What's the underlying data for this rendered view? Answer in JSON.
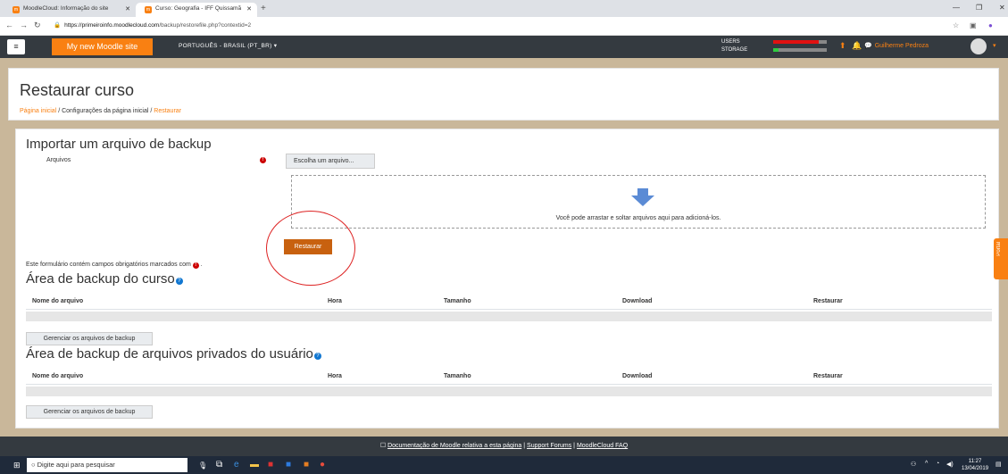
{
  "browser": {
    "tabs": [
      {
        "label": "MoodleCloud: Informação do site"
      },
      {
        "label": "Curso: Geografia - IFF Quissamã"
      }
    ],
    "url_host": "https://primeiroinfo.moodlecloud.com",
    "url_path": "/backup/restorefile.php?contextid=2"
  },
  "navbar": {
    "brand": "My new Moodle site",
    "language": "PORTUGUÊS - BRASIL (PT_BR) ▾",
    "users_label": "USERS",
    "storage_label": "STORAGE",
    "users_fraction": 0.85,
    "storage_fraction": 0.1,
    "username": "Guilherme Pedroza",
    "colors": {
      "brand": "#f98012",
      "nav": "#343a40",
      "users_bar": "#e11111",
      "storage_bar": "#2ecc40"
    }
  },
  "header": {
    "title": "Restaurar curso",
    "breadcrumb": {
      "home": "Página inicial",
      "sep1": "/",
      "config": "Configurações da página inicial",
      "sep2": "/",
      "current": "Restaurar"
    }
  },
  "import": {
    "title": "Importar um arquivo de backup",
    "files_label": "Arquivos",
    "choose_button": "Escolha um arquivo...",
    "drop_text": "Você pode arrastar e soltar arquivos aqui para adicioná-los.",
    "restore_button": "Restaurar",
    "required_note": "Este formulário contém campos obrigatórios marcados com",
    "required_note_end": "."
  },
  "course_backup": {
    "title": "Área de backup do curso",
    "columns": [
      "Nome do arquivo",
      "Hora",
      "Tamanho",
      "Download",
      "Restaurar"
    ],
    "manage_button": "Gerenciar os arquivos de backup"
  },
  "private_backup": {
    "title": "Área de backup de arquivos privados do usuário",
    "columns": [
      "Nome do arquivo",
      "Hora",
      "Tamanho",
      "Download",
      "Restaurar"
    ],
    "manage_button": "Gerenciar os arquivos de backup"
  },
  "footer": {
    "docs_link": "Documentação de Moodle relativa a esta página",
    "sep1": "|",
    "forums_link": "Support Forums",
    "sep2": "|",
    "faq_link": "MoodleCloud FAQ"
  },
  "side_tab": {
    "label": "Portal"
  },
  "taskbar": {
    "search_placeholder": "Digite aqui para pesquisar",
    "time": "11:27",
    "date": "13/04/2019"
  }
}
